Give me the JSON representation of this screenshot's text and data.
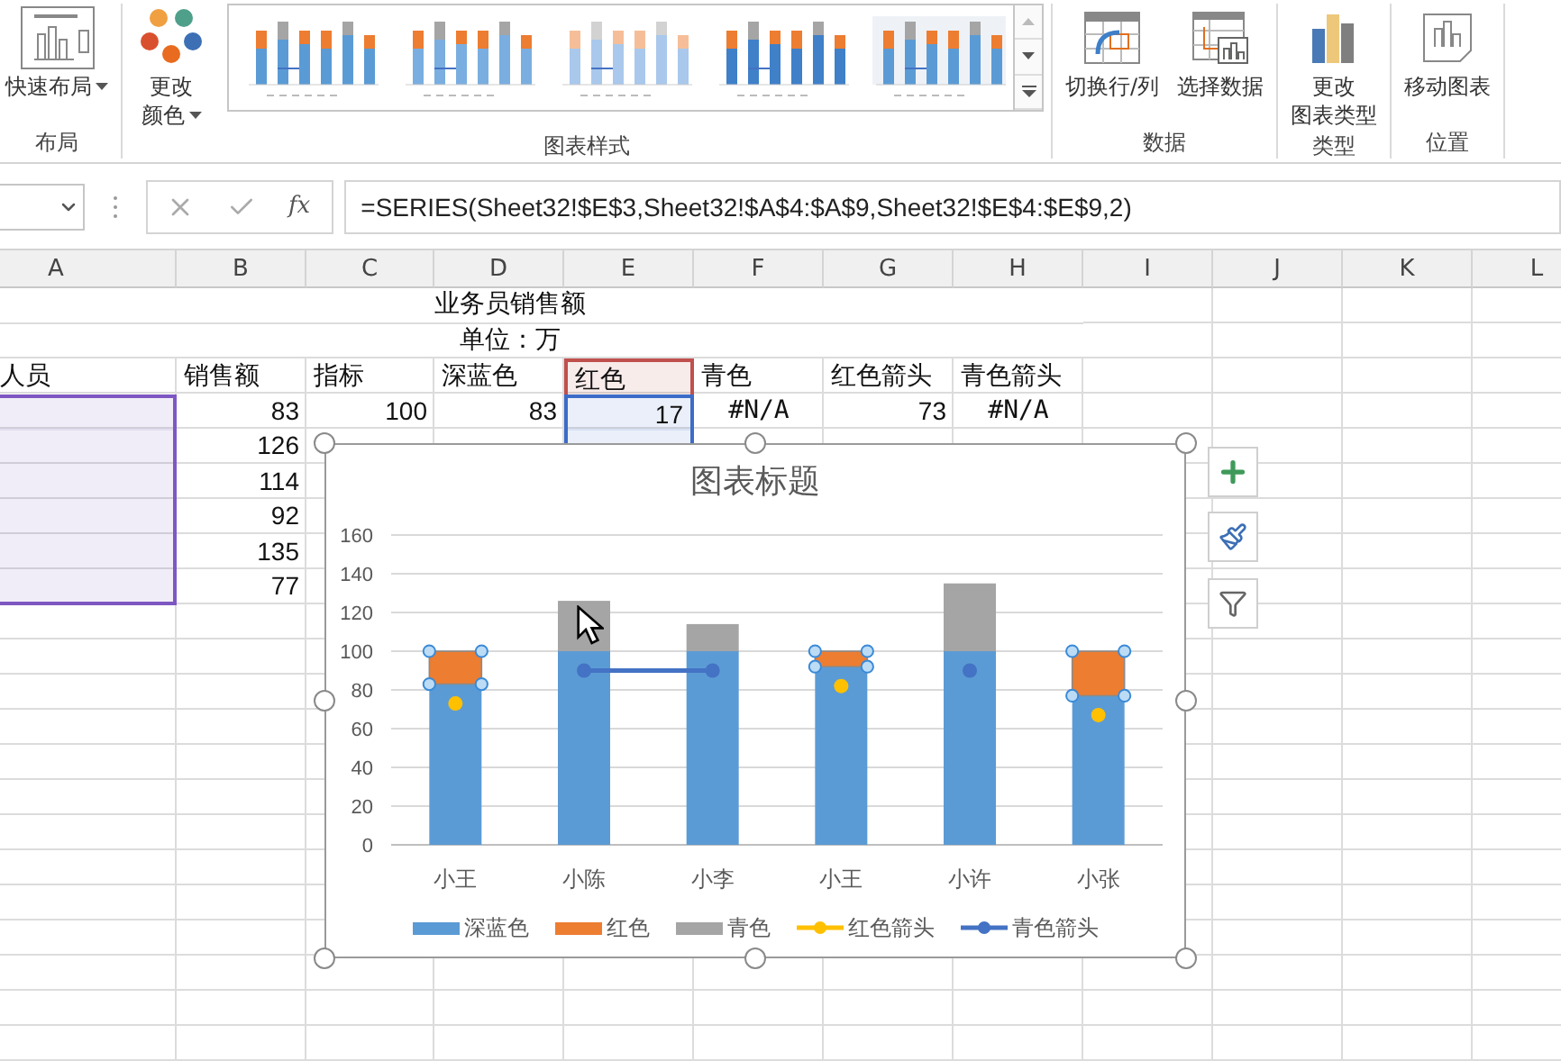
{
  "ribbon": {
    "groups": [
      {
        "kind": "buttons",
        "label": "布局",
        "buttons": [
          {
            "kind": "quick-layout",
            "label": [
              "快速布局"
            ],
            "dropdown": true
          }
        ]
      },
      {
        "kind": "gallery",
        "label": "图表样式",
        "buttons": [
          {
            "kind": "change-colors",
            "label": [
              "更改",
              "颜色"
            ],
            "dropdown": true
          }
        ]
      },
      {
        "kind": "buttons",
        "label": "数据",
        "buttons": [
          {
            "kind": "switch-row-column",
            "label": [
              "切换行/列"
            ],
            "dropdown": false
          },
          {
            "kind": "select-data",
            "label": [
              "选择数据"
            ],
            "dropdown": false
          }
        ]
      },
      {
        "kind": "buttons",
        "label": "类型",
        "buttons": [
          {
            "kind": "change-chart-type",
            "label": [
              "更改",
              "图表类型"
            ],
            "dropdown": false
          }
        ]
      },
      {
        "kind": "buttons",
        "label": "位置",
        "buttons": [
          {
            "kind": "move-chart",
            "label": [
              "移动图表"
            ],
            "dropdown": false
          }
        ]
      }
    ]
  },
  "formula_bar": {
    "function_label": "fx",
    "formula": "=SERIES(Sheet32!$E$3,Sheet32!$A$4:$A$9,Sheet32!$E$4:$E$9,2)"
  },
  "sheet": {
    "columns": [
      "A",
      "B",
      "C",
      "D",
      "E",
      "F",
      "G",
      "H",
      "I",
      "J",
      "K",
      "L"
    ],
    "rows": [
      {
        "kind": "title",
        "text": "业务员销售额"
      },
      {
        "kind": "title",
        "text": "单位：万"
      },
      {
        "kind": "header",
        "cells": [
          {
            "text": "人员"
          },
          {
            "text": "销售额"
          },
          {
            "text": "指标"
          },
          {
            "text": "深蓝色"
          },
          {
            "text": "红色",
            "color": "#c0504d"
          },
          {
            "text": "青色"
          },
          {
            "text": "红色箭头"
          },
          {
            "text": "青色箭头"
          }
        ]
      },
      {
        "kind": "data",
        "cells": [
          {
            "color": "#7e57c2"
          },
          {
            "text": "83",
            "kind": "number"
          },
          {
            "text": "100",
            "kind": "number"
          },
          {
            "text": "83",
            "kind": "number"
          },
          {
            "text": "17",
            "kind": "number",
            "color": "#3c6cc8"
          },
          {
            "text": "#N/A",
            "kind": "error"
          },
          {
            "text": "73",
            "kind": "number"
          },
          {
            "text": "#N/A",
            "kind": "error"
          }
        ]
      },
      {
        "kind": "data",
        "cells": [
          {
            "color": "#7e57c2"
          },
          {
            "text": "126",
            "kind": "number"
          },
          null,
          null,
          {
            "color": "#3c6cc8"
          }
        ]
      },
      {
        "kind": "data",
        "cells": [
          {
            "color": "#7e57c2"
          },
          {
            "text": "114",
            "kind": "number"
          }
        ]
      },
      {
        "kind": "data",
        "cells": [
          {
            "color": "#7e57c2"
          },
          {
            "text": "92",
            "kind": "number"
          }
        ]
      },
      {
        "kind": "data",
        "cells": [
          {
            "color": "#7e57c2"
          },
          {
            "text": "135",
            "kind": "number"
          }
        ]
      },
      {
        "kind": "data",
        "cells": [
          {
            "color": "#7e57c2"
          },
          {
            "text": "77",
            "kind": "number"
          }
        ]
      }
    ]
  },
  "chart": {
    "selected": true,
    "series_selected": [
      false,
      true,
      false,
      false,
      false
    ],
    "chart_data": {
      "type": "bar",
      "title": "图表标题",
      "stacked": true,
      "grid": true,
      "categories": [
        "小王",
        "小陈",
        "小李",
        "小王",
        "小许",
        "小张"
      ],
      "ylim": [
        0,
        160
      ],
      "yticks": [
        0,
        20,
        40,
        60,
        80,
        100,
        120,
        140,
        160
      ],
      "series": [
        {
          "name": "深蓝色",
          "color": "#5b9bd5",
          "values": [
            83,
            100,
            100,
            92,
            100,
            77
          ]
        },
        {
          "name": "红色",
          "color": "#ed7d31",
          "values": [
            17,
            null,
            null,
            8,
            null,
            23
          ]
        },
        {
          "name": "青色",
          "color": "#a5a5a5",
          "values": [
            null,
            26,
            14,
            null,
            35,
            null
          ]
        },
        {
          "name": "红色箭头",
          "type": "scatter",
          "color": "#ffc000",
          "values": [
            73,
            null,
            null,
            82,
            null,
            67
          ]
        },
        {
          "name": "青色箭头",
          "type": "line",
          "marker": true,
          "color": "#4472c4",
          "values": [
            null,
            90,
            90,
            null,
            90,
            null
          ]
        }
      ]
    }
  }
}
